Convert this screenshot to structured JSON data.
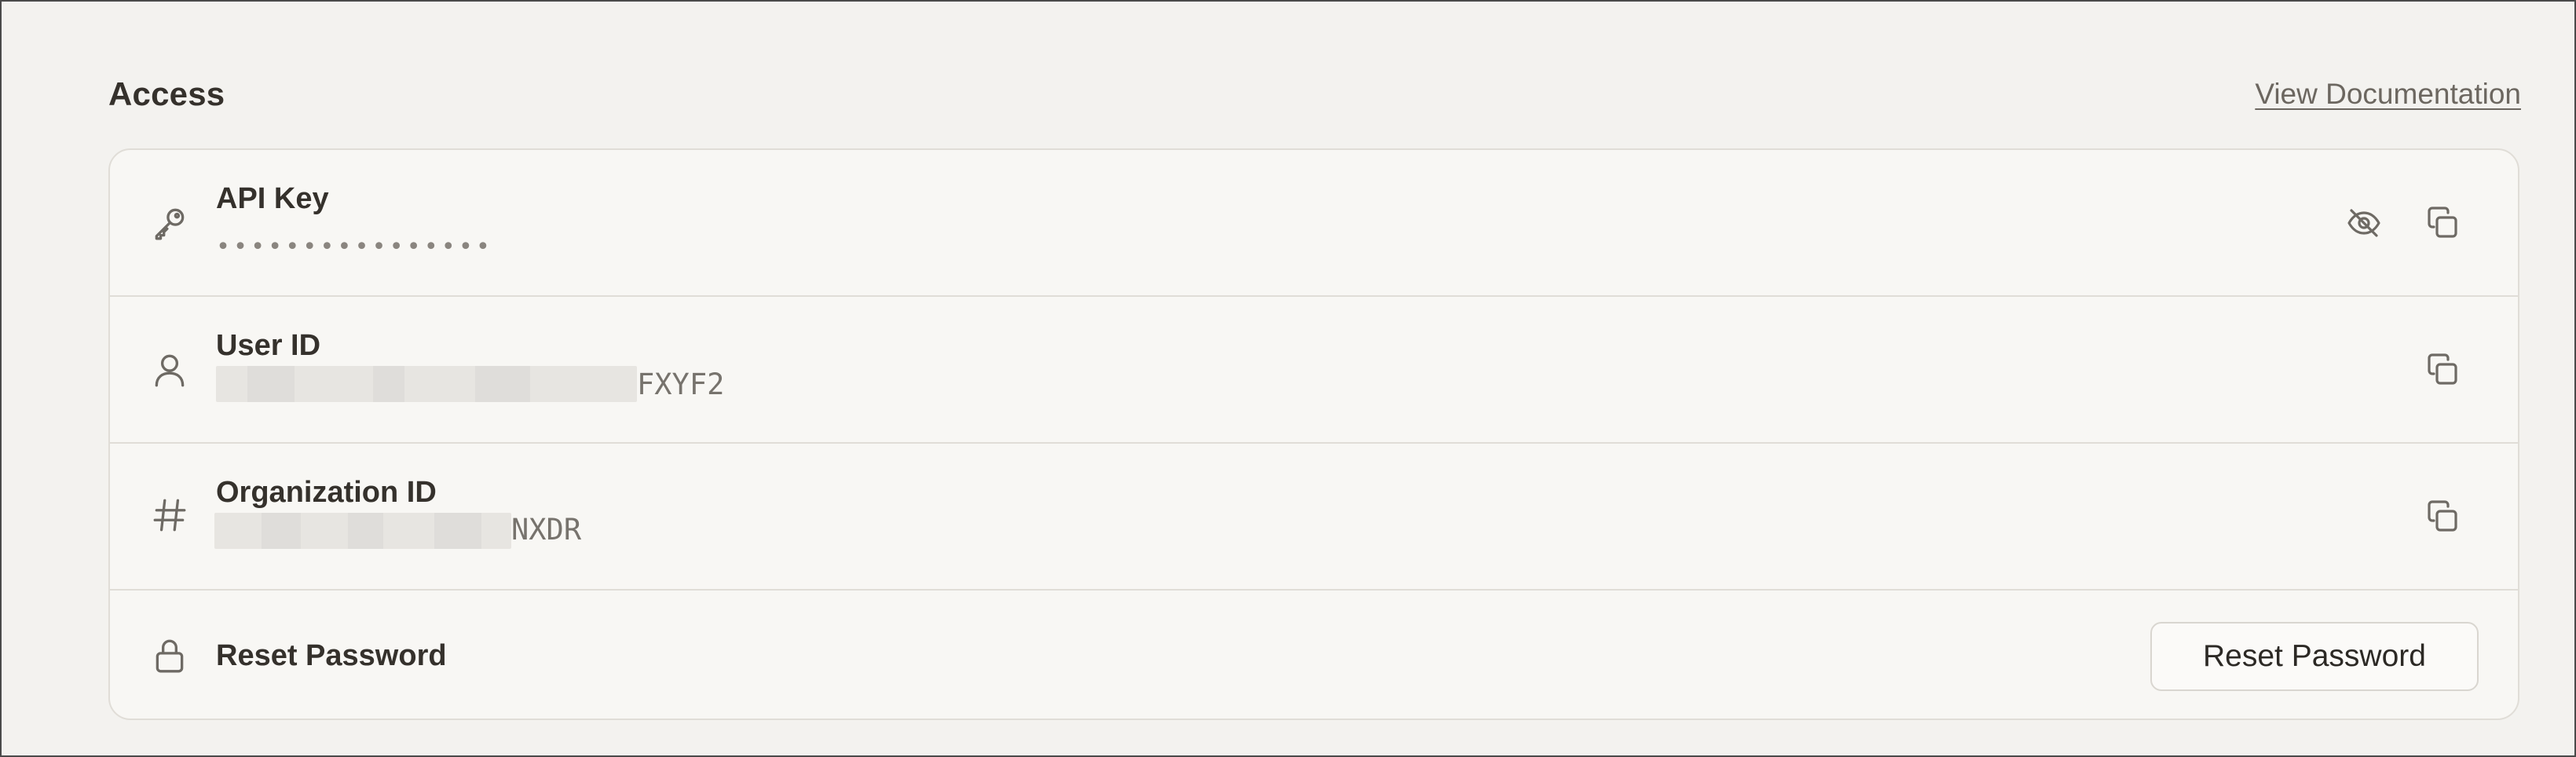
{
  "section": {
    "title": "Access",
    "view_documentation": "View Documentation"
  },
  "rows": {
    "api_key": {
      "icon": "key-icon",
      "label": "API Key",
      "value_masked": "••••••••••••••••",
      "actions": [
        "eye-off-icon",
        "copy-icon"
      ]
    },
    "user_id": {
      "icon": "user-icon",
      "label": "User ID",
      "value_visible_suffix": "FXYF2",
      "actions": [
        "copy-icon"
      ]
    },
    "organization_id": {
      "icon": "hash-icon",
      "label": "Organization ID",
      "value_visible_suffix": "NXDR",
      "actions": [
        "copy-icon"
      ]
    },
    "reset_password": {
      "icon": "lock-icon",
      "label": "Reset Password",
      "button_label": "Reset Password"
    }
  },
  "colors": {
    "background": "#f3f2ef",
    "card_background": "#f8f7f4",
    "border": "#e0ddd7",
    "text_primary": "#35312c",
    "text_secondary": "#77736d",
    "icon": "#6e6a64"
  }
}
